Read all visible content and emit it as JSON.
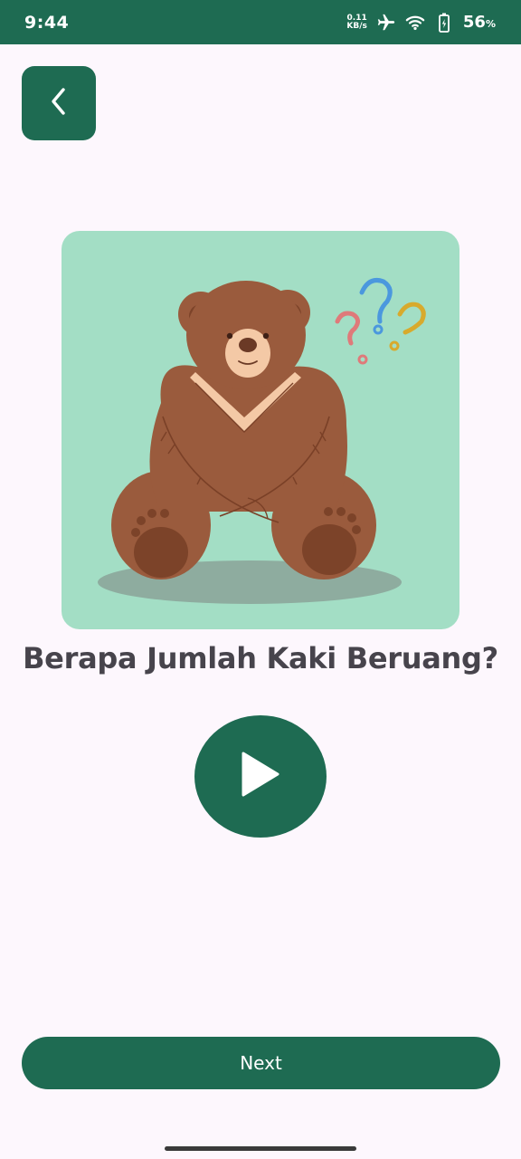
{
  "status_bar": {
    "time": "9:44",
    "net_speed_value": "0.11",
    "net_speed_unit": "KB/s",
    "battery_percent": "56",
    "battery_unit": "%",
    "icons": [
      "airplane-icon",
      "wifi-icon",
      "battery-icon"
    ]
  },
  "header": {
    "back_icon": "chevron-left-icon"
  },
  "quiz": {
    "illustration": "bear-with-question-marks",
    "question": "Berapa Jumlah Kaki Beruang?",
    "play_icon": "play-icon"
  },
  "footer": {
    "next_label": "Next"
  },
  "colors": {
    "primary": "#1e6b52",
    "background": "#fdf7fd",
    "card": "#a3dec5",
    "text": "#47444c"
  }
}
